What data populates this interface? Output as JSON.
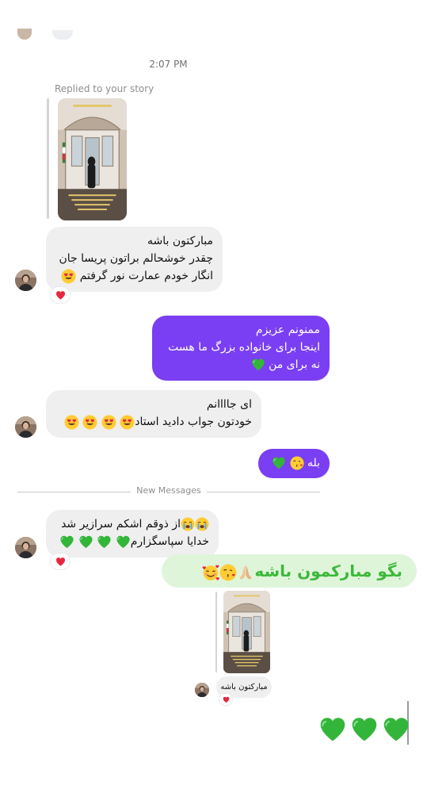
{
  "thread": {
    "timestamp": "2:07 PM",
    "story_reply_label": "Replied to your story",
    "divider_label": "New Messages"
  },
  "messages": {
    "m1": {
      "lines": [
        "مبارکتون باشه",
        "چقدر خوشحالم براتون پریسا جان",
        "انگار خودم عمارت نور گرفتم"
      ],
      "reaction": "heart"
    },
    "m2": {
      "lines": [
        "ممنونم عزیزم",
        "اینجا برای خانواده بزرگ ما هست",
        "نه برای من"
      ]
    },
    "m3": {
      "lines": [
        "ای جاااانم",
        "خودتون جواب دادید استاد"
      ]
    },
    "m4": {
      "lines": [
        "بله"
      ]
    },
    "m5": {
      "lines": [
        "از ذوقم اشکم سرازیر شد",
        "خدایا سپاسگزارم"
      ],
      "reaction": "heart"
    }
  },
  "overlay": {
    "caption": "بگو مبارکمون باشه",
    "mini_message": "مبارکتون باشه"
  },
  "colors": {
    "sent_bubble": "#7a3ff2",
    "received_bubble": "#efefef",
    "caption_text": "#3cb83a",
    "caption_background": "#dff5da"
  },
  "icons": [
    "heart-eyes-emoji",
    "green-heart-emoji",
    "kissing-heart-emoji",
    "crying-emoji",
    "red-heart-icon",
    "praying-hands-emoji",
    "smiling-hearts-emoji"
  ]
}
